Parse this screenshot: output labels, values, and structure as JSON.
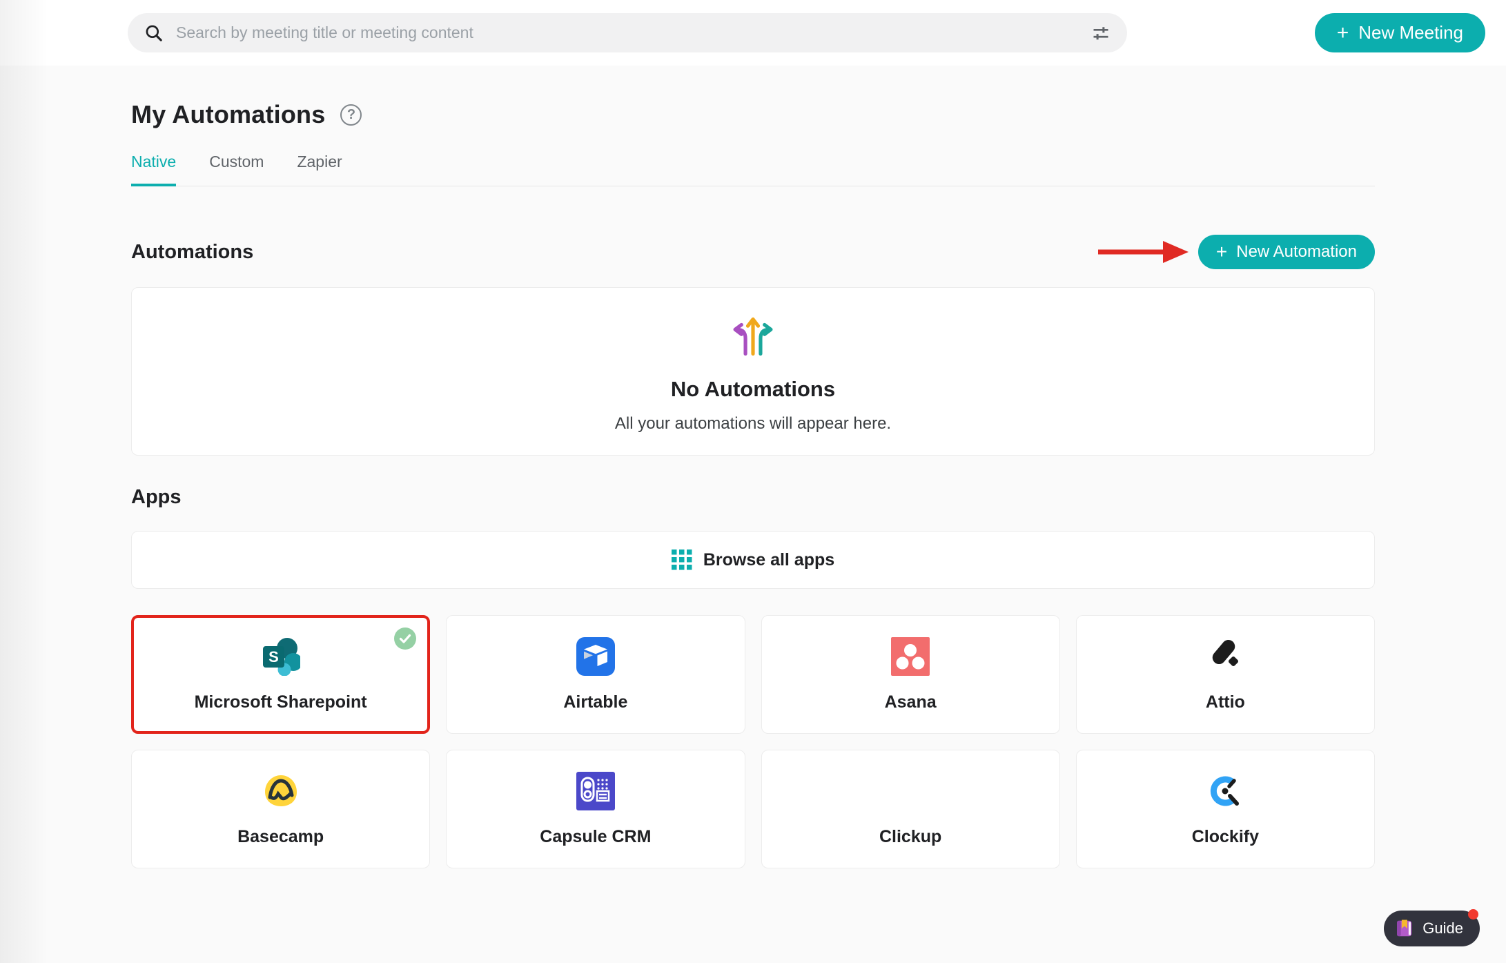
{
  "topbar": {
    "search_placeholder": "Search by meeting title or meeting content",
    "new_meeting_label": "New Meeting",
    "plus": "+"
  },
  "page": {
    "title": "My Automations",
    "help_glyph": "?",
    "tabs": [
      {
        "label": "Native",
        "active": true
      },
      {
        "label": "Custom",
        "active": false
      },
      {
        "label": "Zapier",
        "active": false
      }
    ]
  },
  "automations": {
    "heading": "Automations",
    "new_automation_label": "New Automation",
    "empty_title": "No Automations",
    "empty_subtitle": "All your automations will appear here."
  },
  "apps": {
    "heading": "Apps",
    "browse_label": "Browse all apps",
    "items": [
      {
        "name": "Microsoft Sharepoint",
        "icon": "sharepoint-icon",
        "highlighted": true,
        "connected": true
      },
      {
        "name": "Airtable",
        "icon": "airtable-icon",
        "highlighted": false,
        "connected": false
      },
      {
        "name": "Asana",
        "icon": "asana-icon",
        "highlighted": false,
        "connected": false
      },
      {
        "name": "Attio",
        "icon": "attio-icon",
        "highlighted": false,
        "connected": false
      },
      {
        "name": "Basecamp",
        "icon": "basecamp-icon",
        "highlighted": false,
        "connected": false
      },
      {
        "name": "Capsule CRM",
        "icon": "capsule-icon",
        "highlighted": false,
        "connected": false
      },
      {
        "name": "Clickup",
        "icon": "clickup-icon",
        "highlighted": false,
        "connected": false
      },
      {
        "name": "Clockify",
        "icon": "clockify-icon",
        "highlighted": false,
        "connected": false
      }
    ]
  },
  "guide": {
    "label": "Guide"
  },
  "icons": [
    "search-icon",
    "filter-sliders-icon",
    "plus-icon",
    "help-circle-icon",
    "branching-arrows-icon",
    "red-pointer-arrow-icon",
    "grid-apps-icon",
    "check-badge-icon",
    "book-icon"
  ],
  "colors": {
    "accent_teal": "#0caeae",
    "highlight_red": "#e2241b",
    "arrow_red": "#e02a23",
    "check_badge_green": "#95d0a4",
    "guide_bg": "#32333d",
    "page_bg": "#fafafa",
    "arrow_purple": "#a84fc0",
    "arrow_amber": "#f0a81c",
    "arrow_teal": "#1ba79b"
  }
}
